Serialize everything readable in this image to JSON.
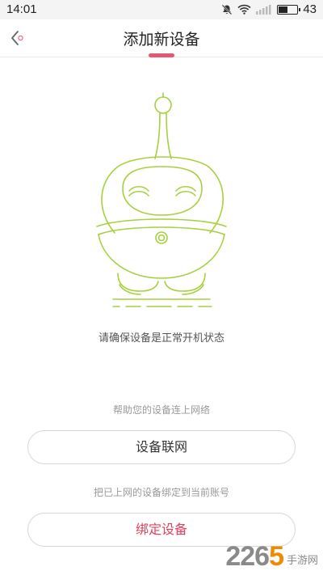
{
  "status_bar": {
    "time": "14:01",
    "battery_level": "43",
    "icons": [
      "notification-off-icon",
      "wifi-icon",
      "signal-icon",
      "battery-icon"
    ]
  },
  "header": {
    "title": "添加新设备",
    "back_icon": "chevron-left-icon",
    "accent_color": "#e8566f"
  },
  "illustration": {
    "name": "robot-icon",
    "color": "#a5d13d"
  },
  "main": {
    "instruction": "请确保设备是正常开机状态",
    "connect_hint": "帮助您的设备连上网络",
    "connect_button": "设备联网",
    "bind_hint": "把已上网的设备绑定到当前账号",
    "bind_button": "绑定设备",
    "bind_button_color": "#e0405e"
  },
  "watermark": {
    "logo": "2265",
    "text": "手游网"
  }
}
